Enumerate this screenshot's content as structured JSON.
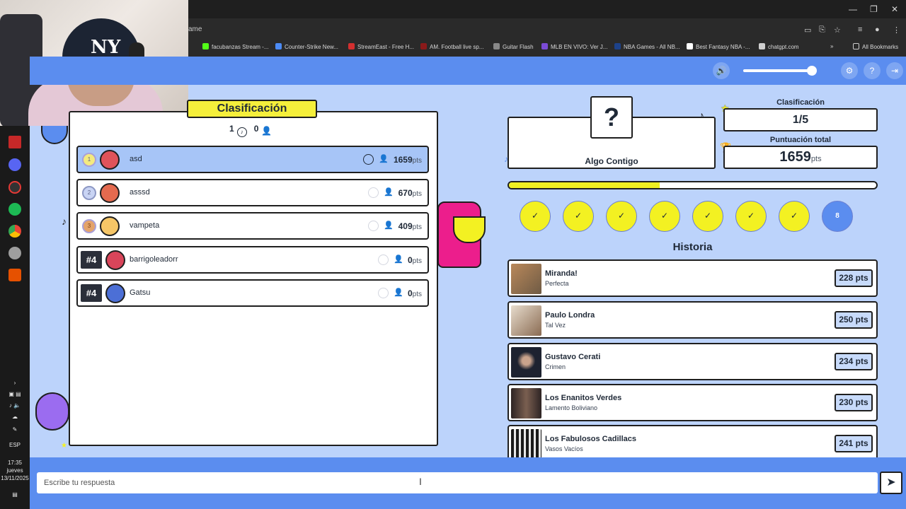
{
  "browser": {
    "url_fragment": "ame",
    "bookmarks": [
      {
        "label": "facubanzas Stream -...",
        "color": "#53fc18"
      },
      {
        "label": "Counter-Strike New...",
        "color": "#4c8bf5"
      },
      {
        "label": "StreamEast - Free H...",
        "color": "#d32f2f"
      },
      {
        "label": "AM. Football live sp...",
        "color": "#8b1a1a"
      },
      {
        "label": "Guitar Flash",
        "color": "#888888"
      },
      {
        "label": "MLB EN VIVO: Ver J...",
        "color": "#7b4bd6"
      },
      {
        "label": "NBA Games - All NB...",
        "color": "#1d428a"
      },
      {
        "label": "Best Fantasy NBA -...",
        "color": "#ffffff"
      },
      {
        "label": "chatgpt.com",
        "color": "#cfcfcf"
      }
    ],
    "all_bookmarks": "All Bookmarks"
  },
  "taskbar": {
    "lang": "ESP",
    "time": "17:35",
    "day": "jueves",
    "date": "13/11/2025"
  },
  "leaderboard": {
    "title": "Clasificación",
    "count_a": "1",
    "count_b": "0",
    "pts_suffix": "pts",
    "players": [
      {
        "rank": "1",
        "name": "asd",
        "score": "1659",
        "active": true,
        "avatar_color": "#e0535a"
      },
      {
        "rank": "2",
        "name": "asssd",
        "score": "670",
        "active": false,
        "avatar_color": "#e46a4f"
      },
      {
        "rank": "3",
        "name": "vampeta",
        "score": "409",
        "active": false,
        "avatar_color": "#f6c667"
      },
      {
        "rank": "#4",
        "name": "barrigoleadorr",
        "score": "0",
        "active": false,
        "avatar_color": "#d9455a"
      },
      {
        "rank": "#4",
        "name": "Gatsu",
        "score": "0",
        "active": false,
        "avatar_color": "#4c6fd6"
      }
    ]
  },
  "current_song": {
    "mystery": "?",
    "title": "Algo Contigo"
  },
  "stats": {
    "rank_label": "Clasificación",
    "rank_value": "1/5",
    "score_label": "Puntuación total",
    "score_value": "1659",
    "score_suffix": "pts"
  },
  "progress_fraction": 0.41,
  "rounds": [
    "✓",
    "✓",
    "✓",
    "✓",
    "✓",
    "✓",
    "✓",
    "8"
  ],
  "history": {
    "title": "Historia",
    "items": [
      {
        "artist": "Miranda!",
        "track": "Perfecta",
        "pts": "228 pts",
        "thumb": "#b9885a"
      },
      {
        "artist": "Paulo Londra",
        "track": "Tal Vez",
        "pts": "250 pts",
        "thumb": "#c9a98a"
      },
      {
        "artist": "Gustavo Cerati",
        "track": "Crimen",
        "pts": "234 pts",
        "thumb": "#1d2230"
      },
      {
        "artist": "Los Enanitos Verdes",
        "track": "Lamento Boliviano",
        "pts": "230 pts",
        "thumb": "#6b5446"
      },
      {
        "artist": "Los Fabulosos Cadillacs",
        "track": "Vasos Vacíos",
        "pts": "241 pts",
        "thumb": "#d8d8d8"
      }
    ]
  },
  "answer": {
    "placeholder": "Escribe tu respuesta",
    "send_icon": "send-arrow-icon"
  },
  "colors": {
    "background": "#bcd3fb",
    "header": "#5b8def",
    "accent_yellow": "#f3f122",
    "active_row": "#a7c5f7"
  }
}
